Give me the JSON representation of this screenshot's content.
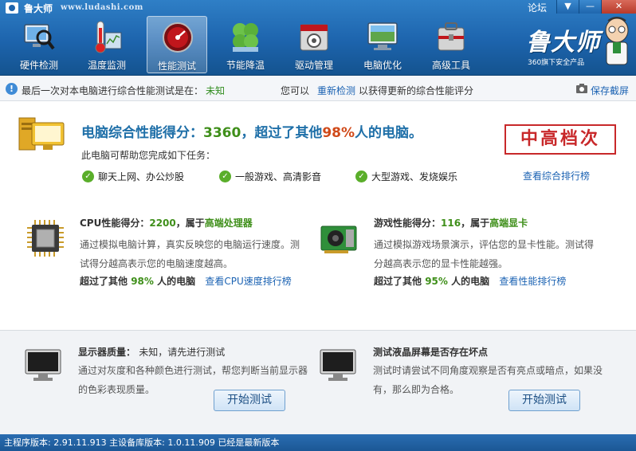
{
  "app": {
    "name": "鲁大师",
    "url": "www.ludashi.com",
    "forum_label": "论坛",
    "brand_name": "鲁大师",
    "brand_tagline": "360旗下安全产品"
  },
  "window_controls": {
    "menu_glyph": "▼",
    "minimize_glyph": "—",
    "close_glyph": "✕"
  },
  "nav": {
    "items": [
      {
        "label": "硬件检测",
        "icon": "hardware-magnifier-icon"
      },
      {
        "label": "温度监测",
        "icon": "thermometer-icon"
      },
      {
        "label": "性能测试",
        "icon": "speedometer-icon",
        "active": true
      },
      {
        "label": "节能降温",
        "icon": "clover-icon"
      },
      {
        "label": "驱动管理",
        "icon": "driver-box-icon"
      },
      {
        "label": "电脑优化",
        "icon": "monitor-optimize-icon"
      },
      {
        "label": "高级工具",
        "icon": "toolbox-icon"
      }
    ]
  },
  "infobar": {
    "prefix": "最后一次对本电脑进行综合性能测试是在：",
    "last_test": "未知",
    "you_can": "您可以",
    "retest_link": "重新检测",
    "suffix": "以获得更新的综合性能评分",
    "save_screenshot": "保存截屏"
  },
  "score": {
    "title_prefix": "电脑综合性能得分：",
    "value": "3360",
    "title_mid": "，超过了其他",
    "percent": "98%",
    "title_suffix": "人的电脑。",
    "can_do": "此电脑可帮助您完成如下任务：",
    "tasks": [
      "聊天上网、办公炒股",
      "一般游戏、高清影音",
      "大型游戏、发烧娱乐"
    ],
    "rank_badge": "中高档次",
    "rank_link": "查看综合排行榜"
  },
  "cpu": {
    "title_prefix": "CPU性能得分：",
    "score": "2200",
    "title_mid": "，属于",
    "level": "高端处理器",
    "desc": "通过模拟电脑计算，真实反映您的电脑运行速度。测试得分越高表示您的电脑速度越高。",
    "beat_prefix": "超过了其他",
    "beat_pct": "98%",
    "beat_suffix": "人的电脑",
    "rank_link": "查看CPU速度排行榜"
  },
  "gpu": {
    "title_prefix": "游戏性能得分：",
    "score": "116",
    "title_mid": "，属于",
    "level": "高端显卡",
    "desc": "通过模拟游戏场景演示，评估您的显卡性能。测试得分越高表示您的显卡性能越强。",
    "beat_prefix": "超过了其他",
    "beat_pct": "95%",
    "beat_suffix": "人的电脑",
    "rank_link": "查看性能排行榜"
  },
  "display_quality": {
    "title": "显示器质量：",
    "status": "未知，请先进行测试",
    "desc": "通过对灰度和各种颜色进行测试，帮您判断当前显示器的色彩表现质量。",
    "button": "开始测试"
  },
  "lcd_dead_pixel": {
    "title": "测试液晶屏幕是否存在坏点",
    "desc": "测试时请尝试不同角度观察是否有亮点或暗点，如果没有，那么即为合格。",
    "button": "开始测试"
  },
  "statusbar": {
    "text": "主程序版本: 2.91.11.913  主设备库版本: 1.0.11.909  已经是最新版本"
  },
  "colors": {
    "titlebar": "#1d64ad",
    "score_title": "#1e6fa8",
    "green": "#3f8f1a",
    "orange": "#d04a1a",
    "link": "#1c63b3",
    "stamp_red": "#c8282a"
  }
}
